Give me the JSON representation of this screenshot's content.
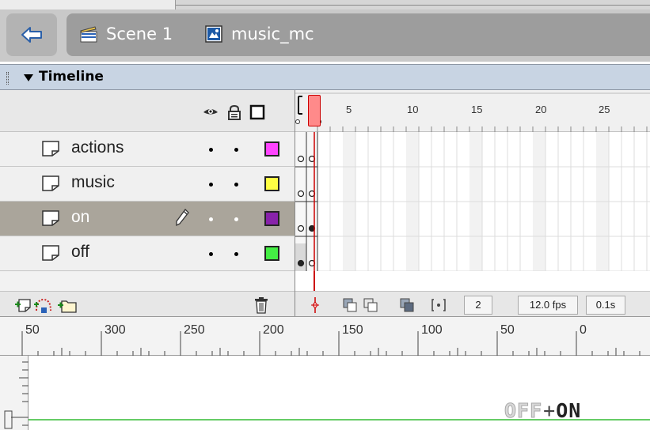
{
  "nav": {
    "scene_label": "Scene 1",
    "symbol_label": "music_mc"
  },
  "timeline": {
    "title": "Timeline",
    "frame_numbers": [
      "5",
      "10",
      "15",
      "20",
      "25"
    ],
    "layers": [
      {
        "name": "actions",
        "color": "#ff44ff",
        "selected": false
      },
      {
        "name": "music",
        "color": "#ffff44",
        "selected": false
      },
      {
        "name": "on",
        "color": "#8822aa",
        "selected": true
      },
      {
        "name": "off",
        "color": "#44ee44",
        "selected": false
      }
    ],
    "current_frame": "2",
    "frame_rate": "12.0 fps",
    "elapsed_time": "0.1s"
  },
  "ruler": {
    "labels": [
      "50",
      "300",
      "250",
      "200",
      "150",
      "100",
      "50",
      "0"
    ]
  },
  "stage": {
    "logo_off": "OFF",
    "logo_plus": "+",
    "logo_on": "ON"
  }
}
